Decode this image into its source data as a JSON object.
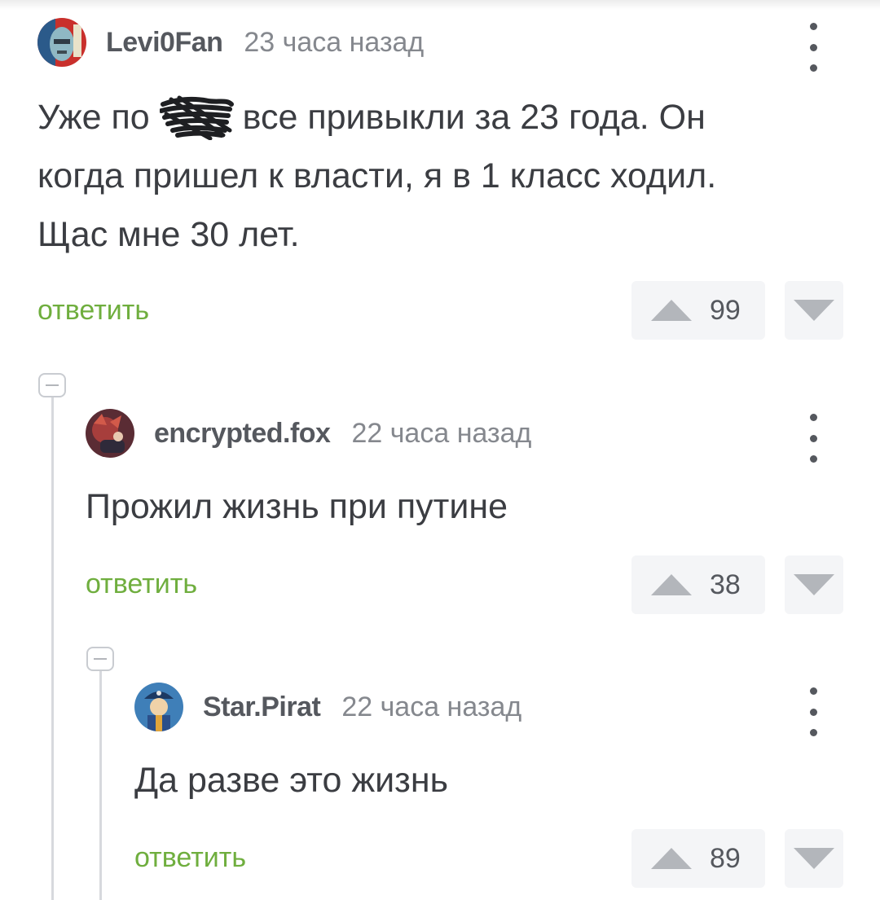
{
  "comments": [
    {
      "username": "Levi0Fan",
      "time": "23 часа назад",
      "text_before": "Уже по ",
      "text_censored": "хуй",
      "text_after": " все привыкли за 23 года. Он\nкогда пришел к власти, я в 1 класс ходил.\nЩас мне 30 лет.",
      "reply_label": "ответить",
      "votes": "99"
    },
    {
      "username": "encrypted.fox",
      "time": "22 часа назад",
      "text": "Прожил жизнь при путине",
      "reply_label": "ответить",
      "votes": "38"
    },
    {
      "username": "Star.Pirat",
      "time": "22 часа назад",
      "text": "Да разве это жизнь",
      "reply_label": "ответить",
      "votes": "89"
    }
  ],
  "icons": {
    "more": "more-vertical-icon",
    "upvote": "upvote-triangle-icon",
    "downvote": "downvote-triangle-icon",
    "collapse": "collapse-minus-icon"
  },
  "colors": {
    "reply_green": "#6fae3e",
    "vote_bg": "#f4f5f7",
    "vote_triangle": "#b3b6bb"
  }
}
